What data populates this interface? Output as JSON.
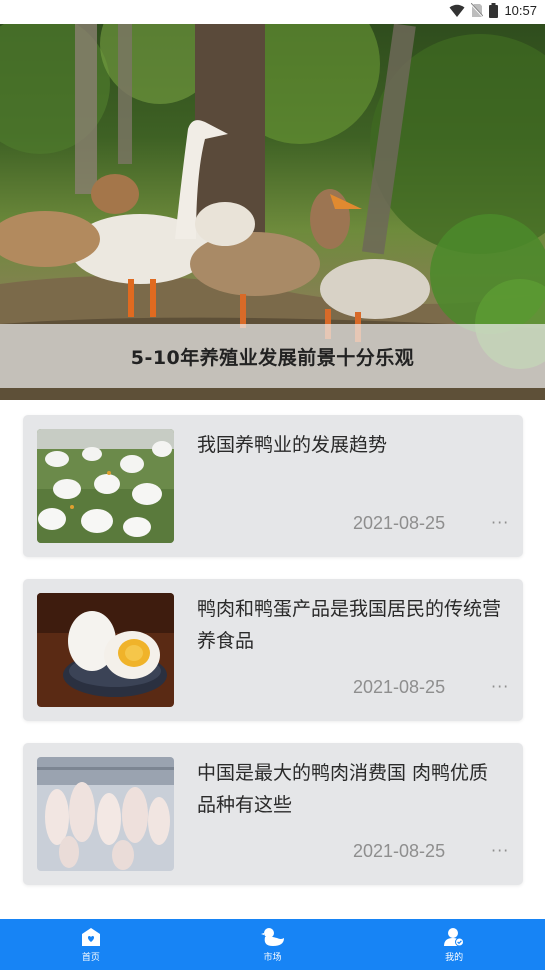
{
  "status_bar": {
    "time": "10:57",
    "icons": [
      "wifi-icon",
      "no-sim-icon",
      "battery-icon"
    ]
  },
  "hero": {
    "caption": "5-10年养殖业发展前景十分乐观"
  },
  "articles": [
    {
      "title": "我国养鸭业的发展趋势",
      "date": "2021-08-25",
      "more": "···",
      "thumb": "white-ducks-on-grass"
    },
    {
      "title": "鸭肉和鸭蛋产品是我国居民的传统营养食品",
      "date": "2021-08-25",
      "more": "···",
      "thumb": "salted-duck-eggs"
    },
    {
      "title": "中国是最大的鸭肉消费国 肉鸭优质品种有这些",
      "date": "2021-08-25",
      "more": "···",
      "thumb": "processed-ducks-line"
    }
  ],
  "bottom_nav": [
    {
      "label": "首页",
      "icon": "home-icon"
    },
    {
      "label": "市场",
      "icon": "duck-icon"
    },
    {
      "label": "我的",
      "icon": "user-icon"
    }
  ],
  "colors": {
    "nav_bg": "#1784f5",
    "card_bg": "#e5e6e8",
    "date": "#8e8e8e"
  }
}
